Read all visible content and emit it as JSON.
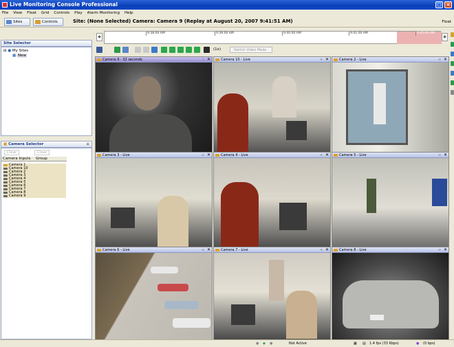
{
  "window": {
    "title": "Live Monitoring Console Professional"
  },
  "menu": [
    "File",
    "View",
    "Float",
    "Grid",
    "Controls",
    "Play",
    "Alarm Monitoring",
    "Help"
  ],
  "toolbar": {
    "sites_label": "Sites",
    "controls_label": "Controls",
    "site_text": "Site: (None Selected)    Camera: Camera 9 (Replay at August 20, 2007 9:41:51 AM)",
    "float_label": "Float"
  },
  "site_selector": {
    "title": "Site Selector",
    "root": "My Sites",
    "child": "New"
  },
  "camera_selector": {
    "title": "Camera Selector",
    "btn_add": "Clear",
    "btn_remove": "Clear",
    "columns": [
      "Camera Inputs",
      "Group"
    ],
    "cameras": [
      "Camera 1",
      "Camera 10",
      "Camera 2",
      "Camera 3",
      "Camera 4",
      "Camera 5",
      "Camera 6",
      "Camera 7",
      "Camera 8",
      "Camera 9"
    ]
  },
  "timeline": {
    "ticks": [
      "9:38:00 AM",
      "9:39:00 AM",
      "9:40:00 AM",
      "9:41:00 AM",
      "9:42:00 AM"
    ]
  },
  "controls": {
    "speed": "(1x)",
    "mode_select": "Switch Video Mode"
  },
  "tiles": [
    {
      "label": "Camera 9 - 32 seconds",
      "selected": true
    },
    {
      "label": "Camera 10 - Live"
    },
    {
      "label": "Camera 2 - Live"
    },
    {
      "label": "Camera 3 - Live"
    },
    {
      "label": "Camera 4 - Live"
    },
    {
      "label": "Camera 5 - Live"
    },
    {
      "label": "Camera 6 - Live"
    },
    {
      "label": "Camera 7 - Live"
    },
    {
      "label": "Camera 8 - Live"
    }
  ],
  "status": {
    "state": "Not Active",
    "fps": "1.4 fps (33 Kbps)",
    "rate": "(0 bps)"
  },
  "colors": {
    "title_blue": "#0a3fb8",
    "selected_tile": "#a89ee0",
    "timeline_red": "#ecb2b2"
  }
}
